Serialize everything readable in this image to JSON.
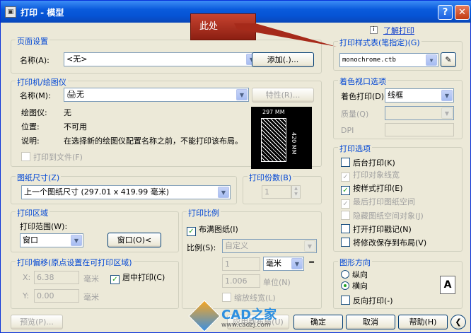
{
  "window": {
    "title": "打印 - 模型",
    "help": "?",
    "close": "✕"
  },
  "callout": {
    "text": "此处"
  },
  "page_setup": {
    "title": "页面设置",
    "name_label": "名称(A):",
    "name_value": "<无>",
    "add_button": "添加(.)..."
  },
  "plotter": {
    "title": "打印机/绘图仪",
    "name_label": "名称(M):",
    "name_value": "无",
    "properties_button": "特性(R)...",
    "plotter_label": "绘图仪:",
    "plotter_value": "无",
    "where_label": "位置:",
    "where_value": "不可用",
    "desc_label": "说明:",
    "desc_value": "在选择新的绘图仪配置名称之前，不能打印该布局。",
    "plot_to_file": "打印到文件(F)",
    "dim_width": "297 MM",
    "dim_height": "420 MM"
  },
  "paper_size": {
    "title": "图纸尺寸(Z)",
    "value": "上一个图纸尺寸 (297.01 x 419.99 毫米)"
  },
  "copies": {
    "title": "打印份数(B)",
    "value": "1"
  },
  "plot_area": {
    "title": "打印区域",
    "what_label": "打印范围(W):",
    "what_value": "窗口",
    "window_button": "窗口(O)<"
  },
  "plot_offset": {
    "title": "打印偏移(原点设置在可打印区域)",
    "x_label": "X:",
    "x_value": "6.38",
    "y_label": "Y:",
    "y_value": "0.00",
    "unit": "毫米",
    "center": "居中打印(C)"
  },
  "plot_scale": {
    "title": "打印比例",
    "fit": "布满图纸(I)",
    "scale_label": "比例(S):",
    "scale_value": "自定义",
    "val1": "1",
    "unit_value": "毫米",
    "eq": "=",
    "val2": "1.006",
    "unit_label": "单位(N)",
    "lineweights": "缩放线宽(L)"
  },
  "style_table": {
    "title": "打印样式表(笔指定)(G)",
    "learn": "了解打印",
    "value": "monochrome.ctb"
  },
  "shaded": {
    "title": "着色视口选项",
    "shade_label": "着色打印(D)",
    "shade_value": "线框",
    "quality_label": "质量(Q)",
    "dpi_label": "DPI"
  },
  "options": {
    "title": "打印选项",
    "items": [
      {
        "label": "后台打印(K)",
        "checked": false,
        "disabled": false
      },
      {
        "label": "打印对象线宽",
        "checked": true,
        "disabled": true
      },
      {
        "label": "按样式打印(E)",
        "checked": true,
        "disabled": false
      },
      {
        "label": "最后打印图纸空间",
        "checked": true,
        "disabled": true
      },
      {
        "label": "隐藏图纸空间对象(J)",
        "checked": false,
        "disabled": true
      },
      {
        "label": "打开打印戳记(N)",
        "checked": false,
        "disabled": false
      },
      {
        "label": "将修改保存到布局(V)",
        "checked": false,
        "disabled": false
      }
    ]
  },
  "orientation": {
    "title": "图形方向",
    "portrait": "纵向",
    "landscape": "横向",
    "upside": "反向打印(-)",
    "icon": "A"
  },
  "buttons": {
    "preview": "预览(P)...",
    "apply": "应用到布局(U)",
    "ok": "确定",
    "cancel": "取消",
    "help": "帮助(H)"
  },
  "watermark": {
    "text": "CAD之家",
    "url": "www.cadzj.com"
  }
}
